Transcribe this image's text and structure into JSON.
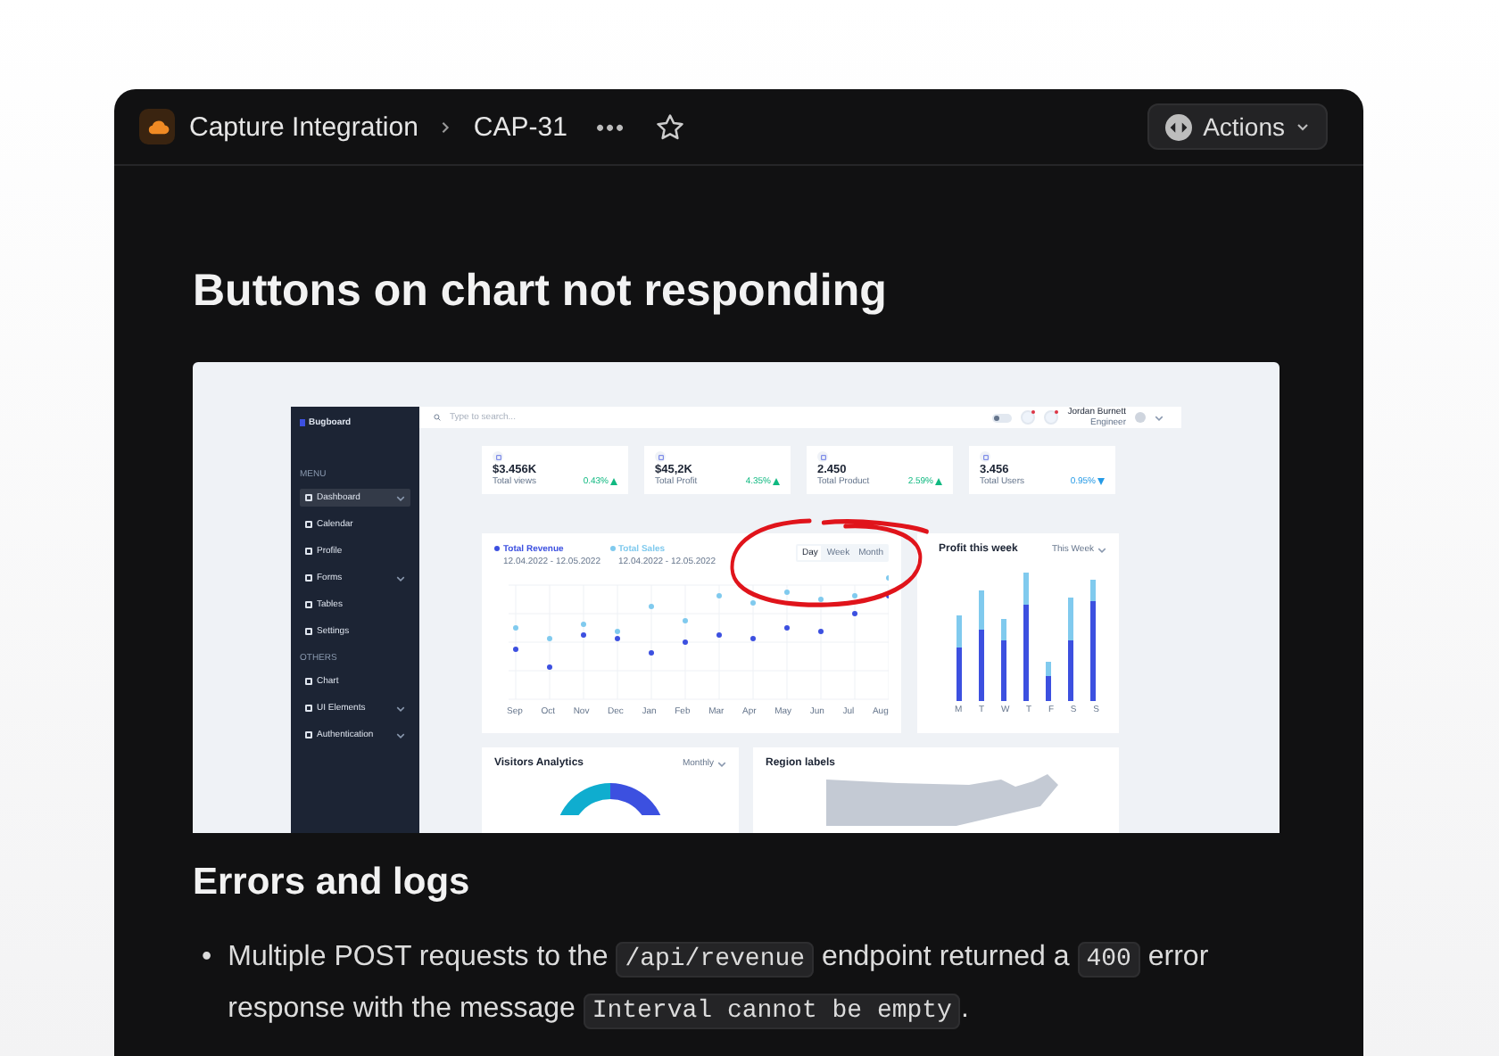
{
  "header": {
    "project": "Capture Integration",
    "issue": "CAP-31",
    "more": "•••",
    "actions": "Actions"
  },
  "issue": {
    "title": "Buttons on chart not responding"
  },
  "attachment": {
    "app": "Bugboard",
    "dark_mode": false,
    "search_placeholder": "Type to search...",
    "user_name": "Jordan Burnett",
    "user_role": "Engineer",
    "menu_heading": "MENU",
    "menu": [
      {
        "label": "Dashboard",
        "selected": true,
        "expandable": true
      },
      {
        "label": "Calendar",
        "selected": false,
        "expandable": false
      },
      {
        "label": "Profile",
        "selected": false,
        "expandable": false
      },
      {
        "label": "Forms",
        "selected": false,
        "expandable": true
      },
      {
        "label": "Tables",
        "selected": false,
        "expandable": false
      },
      {
        "label": "Settings",
        "selected": false,
        "expandable": false
      }
    ],
    "others_heading": "OTHERS",
    "others": [
      {
        "label": "Chart",
        "selected": false,
        "expandable": false
      },
      {
        "label": "UI Elements",
        "selected": false,
        "expandable": true
      },
      {
        "label": "Authentication",
        "selected": false,
        "expandable": true
      }
    ],
    "stats": [
      {
        "value": "$3.456K",
        "label": "Total views",
        "change": "0.43%",
        "kind": "increase",
        "color": "#10b981"
      },
      {
        "value": "$45,2K",
        "label": "Total Profit",
        "change": "4.35%",
        "kind": "increase",
        "color": "#10b981"
      },
      {
        "value": "2.450",
        "label": "Total Product",
        "change": "2.59%",
        "kind": "increase",
        "color": "#10b981"
      },
      {
        "value": "3.456",
        "label": "Total Users",
        "change": "0.95%",
        "kind": "decrease",
        "color": "#259ae6"
      }
    ],
    "revenue_chart": {
      "series": [
        {
          "name": "Total Revenue",
          "dates": "12.04.2022 - 12.05.2022",
          "color": "#3c50e0"
        },
        {
          "name": "Total Sales",
          "dates": "12.04.2022 - 12.05.2022",
          "color": "#80caee"
        }
      ],
      "ranges": [
        {
          "label": "Day",
          "selected": true
        },
        {
          "label": "Week",
          "selected": false
        },
        {
          "label": "Month",
          "selected": false
        }
      ],
      "months": [
        "Sep",
        "Oct",
        "Nov",
        "Dec",
        "Jan",
        "Feb",
        "Mar",
        "Apr",
        "May",
        "Jun",
        "Jul",
        "Aug"
      ]
    },
    "profit_chart": {
      "title": "Profit this week",
      "period": "This Week",
      "days": [
        "M",
        "T",
        "W",
        "T",
        "F",
        "S",
        "S"
      ]
    },
    "visitors": {
      "title": "Visitors Analytics",
      "period": "Monthly"
    },
    "region": {
      "title": "Region labels"
    }
  },
  "section": {
    "heading": "Errors and logs"
  },
  "bullets": [
    {
      "marker": "•",
      "parts": [
        {
          "kind": "text",
          "text": "Multiple POST requests to the "
        },
        {
          "kind": "code",
          "text": "/api/revenue"
        },
        {
          "kind": "text",
          "text": " endpoint returned a "
        },
        {
          "kind": "code",
          "text": "400"
        },
        {
          "kind": "text",
          "text": " error response with the message "
        },
        {
          "kind": "code",
          "text": "Interval cannot be empty"
        },
        {
          "kind": "text",
          "text": "."
        }
      ]
    }
  ]
}
